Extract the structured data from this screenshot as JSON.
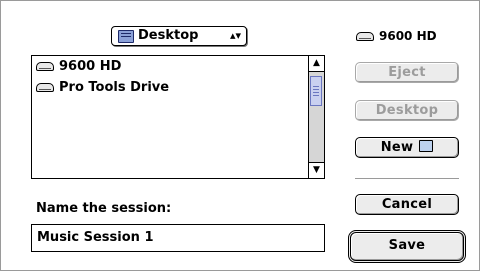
{
  "location_popup": {
    "label": "Desktop",
    "icon": "desktop-folder-icon",
    "arrows": "▴▾"
  },
  "file_list": {
    "items": [
      {
        "label": "9600 HD",
        "icon": "hard-disk-icon"
      },
      {
        "label": "Pro Tools Drive",
        "icon": "hard-disk-icon"
      }
    ]
  },
  "volume": {
    "label": "9600 HD",
    "icon": "hard-disk-icon"
  },
  "buttons": {
    "eject": "Eject",
    "desktop": "Desktop",
    "new": "New",
    "cancel": "Cancel",
    "save": "Save"
  },
  "name_field": {
    "label": "Name the session:",
    "value": "Music Session 1"
  }
}
